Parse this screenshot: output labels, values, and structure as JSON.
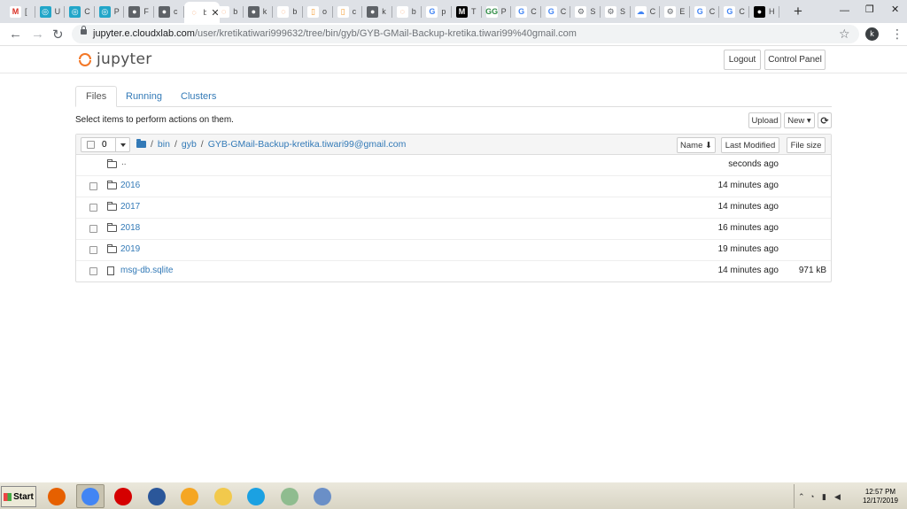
{
  "browser": {
    "tabs": [
      {
        "icon": "gmail-icon",
        "label": "[",
        "color": "#ffffff",
        "glyph": "M",
        "glyph_color": "#d93025"
      },
      {
        "icon": "cloudxlab-icon",
        "label": "U",
        "color": "#22a6c9",
        "glyph": "◎"
      },
      {
        "icon": "cloudxlab-icon",
        "label": "C",
        "color": "#22a6c9",
        "glyph": "◎"
      },
      {
        "icon": "cloudxlab-icon",
        "label": "P",
        "color": "#22a6c9",
        "glyph": "◎"
      },
      {
        "icon": "globe-icon",
        "label": "F",
        "color": "#5f6368",
        "glyph": "●"
      },
      {
        "icon": "globe-icon",
        "label": "c",
        "color": "#5f6368",
        "glyph": "●"
      },
      {
        "icon": "jupyter-icon",
        "label": "bi",
        "color": "#ffffff",
        "glyph": "◌",
        "glyph_color": "#f37726",
        "active": true
      },
      {
        "icon": "jupyter-icon",
        "label": "b",
        "color": "#ffffff",
        "glyph": "◌",
        "glyph_color": "#f37726"
      },
      {
        "icon": "globe-icon",
        "label": "k",
        "color": "#5f6368",
        "glyph": "●"
      },
      {
        "icon": "jupyter-icon",
        "label": "b",
        "color": "#ffffff",
        "glyph": "◌",
        "glyph_color": "#f37726"
      },
      {
        "icon": "document-icon",
        "label": "o",
        "color": "#ffffff",
        "glyph": "▯",
        "glyph_color": "#f39c34"
      },
      {
        "icon": "document-icon",
        "label": "c",
        "color": "#ffffff",
        "glyph": "▯",
        "glyph_color": "#f39c34"
      },
      {
        "icon": "globe-icon",
        "label": "k",
        "color": "#5f6368",
        "glyph": "●"
      },
      {
        "icon": "jupyter-icon",
        "label": "b",
        "color": "#ffffff",
        "glyph": "◌",
        "glyph_color": "#f37726"
      },
      {
        "icon": "google-icon",
        "label": "p",
        "color": "#ffffff",
        "glyph": "G",
        "glyph_color": "#4285f4"
      },
      {
        "icon": "medium-icon",
        "label": "T",
        "color": "#000000",
        "glyph": "M"
      },
      {
        "icon": "geeksforgeeks-icon",
        "label": "P",
        "color": "#ffffff",
        "glyph": "GG",
        "glyph_color": "#2f8d46"
      },
      {
        "icon": "google-icon",
        "label": "C",
        "color": "#ffffff",
        "glyph": "G",
        "glyph_color": "#4285f4"
      },
      {
        "icon": "google-icon",
        "label": "C",
        "color": "#ffffff",
        "glyph": "G",
        "glyph_color": "#4285f4"
      },
      {
        "icon": "settings-icon",
        "label": "S",
        "color": "#ffffff",
        "glyph": "⚙",
        "glyph_color": "#5f6368"
      },
      {
        "icon": "settings-icon",
        "label": "S",
        "color": "#ffffff",
        "glyph": "⚙",
        "glyph_color": "#5f6368"
      },
      {
        "icon": "google-cloud-icon",
        "label": "C",
        "color": "#ffffff",
        "glyph": "☁",
        "glyph_color": "#4285f4"
      },
      {
        "icon": "settings-icon",
        "label": "E",
        "color": "#ffffff",
        "glyph": "⚙",
        "glyph_color": "#5f6368"
      },
      {
        "icon": "google-icon",
        "label": "C",
        "color": "#ffffff",
        "glyph": "G",
        "glyph_color": "#4285f4"
      },
      {
        "icon": "google-icon",
        "label": "C",
        "color": "#ffffff",
        "glyph": "G",
        "glyph_color": "#4285f4"
      },
      {
        "icon": "github-icon",
        "label": "H",
        "color": "#000000",
        "glyph": "●"
      }
    ],
    "new_tab": "+",
    "url_host": "jupyter.e.cloudxlab.com",
    "url_path": "/user/kretikatiwari999632/tree/bin/gyb/GYB-GMail-Backup-kretika.tiwari99%40gmail.com",
    "profile_initial": "k"
  },
  "jupyter": {
    "logo_text": "jupyter",
    "logout_label": "Logout",
    "control_panel_label": "Control Panel",
    "tabs": [
      "Files",
      "Running",
      "Clusters"
    ],
    "hint": "Select items to perform actions on them.",
    "upload_label": "Upload",
    "new_label": "New ▾",
    "refresh_glyph": "⟳",
    "selected_count": "0",
    "breadcrumbs": [
      "bin",
      "gyb",
      "GYB-GMail-Backup-kretika.tiwari99@gmail.com"
    ],
    "sort_name_label": "Name ⬇",
    "sort_modified_label": "Last Modified",
    "sort_size_label": "File size",
    "rows": [
      {
        "type": "up",
        "name": "..",
        "modified": "seconds ago",
        "size": ""
      },
      {
        "type": "folder",
        "name": "2016",
        "modified": "14 minutes ago",
        "size": ""
      },
      {
        "type": "folder",
        "name": "2017",
        "modified": "14 minutes ago",
        "size": ""
      },
      {
        "type": "folder",
        "name": "2018",
        "modified": "16 minutes ago",
        "size": ""
      },
      {
        "type": "folder",
        "name": "2019",
        "modified": "19 minutes ago",
        "size": ""
      },
      {
        "type": "file",
        "name": "msg-db.sqlite",
        "modified": "14 minutes ago",
        "size": "971 kB"
      }
    ]
  },
  "taskbar": {
    "start_label": "Start",
    "apps": [
      {
        "icon": "firefox-icon",
        "color": "#e66000"
      },
      {
        "icon": "chrome-icon",
        "color": "#4285f4",
        "active": true
      },
      {
        "icon": "opera-icon",
        "color": "#d50000"
      },
      {
        "icon": "word-icon",
        "color": "#2b579a"
      },
      {
        "icon": "media-player-icon",
        "color": "#f5a623"
      },
      {
        "icon": "folder-icon",
        "color": "#f2c94c"
      },
      {
        "icon": "internet-explorer-icon",
        "color": "#1ba1e2"
      },
      {
        "icon": "paint-icon",
        "color": "#8fbc8f"
      },
      {
        "icon": "window-app-icon",
        "color": "#6a8fc7"
      }
    ],
    "time": "12:57 PM",
    "date": "12/17/2019"
  }
}
